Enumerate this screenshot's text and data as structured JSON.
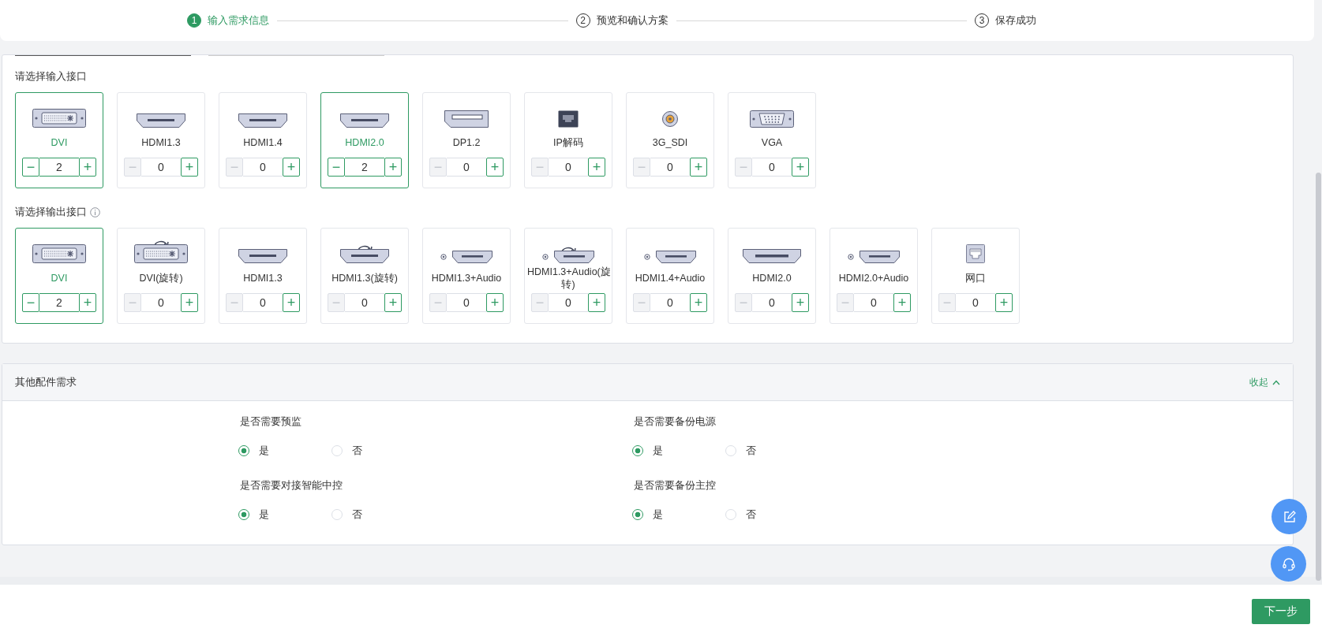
{
  "steps": [
    {
      "number": "1",
      "label": "输入需求信息",
      "selected": true
    },
    {
      "number": "2",
      "label": "预览和确认方案",
      "selected": false
    },
    {
      "number": "3",
      "label": "保存成功",
      "selected": false
    }
  ],
  "input_ports": {
    "title": "请选择输入接口",
    "items": [
      {
        "kind": "dvi",
        "rotated": false,
        "label": "DVI",
        "selected": true,
        "minus_disabled": false,
        "value": "2",
        "minus": "−",
        "plus": "+"
      },
      {
        "kind": "hdmi",
        "rotated": false,
        "label": "HDMI1.3",
        "selected": false,
        "minus_disabled": true,
        "value": "0",
        "minus": "−",
        "plus": "+"
      },
      {
        "kind": "hdmi",
        "rotated": false,
        "label": "HDMI1.4",
        "selected": false,
        "minus_disabled": true,
        "value": "0",
        "minus": "−",
        "plus": "+"
      },
      {
        "kind": "hdmi",
        "rotated": false,
        "label": "HDMI2.0",
        "selected": true,
        "minus_disabled": false,
        "value": "2",
        "minus": "−",
        "plus": "+"
      },
      {
        "kind": "dp",
        "rotated": false,
        "label": "DP1.2",
        "selected": false,
        "minus_disabled": true,
        "value": "0",
        "minus": "−",
        "plus": "+"
      },
      {
        "kind": "ip",
        "rotated": false,
        "label": "IP解码",
        "selected": false,
        "minus_disabled": true,
        "value": "0",
        "minus": "−",
        "plus": "+"
      },
      {
        "kind": "bnc",
        "rotated": false,
        "label": "3G_SDI",
        "selected": false,
        "minus_disabled": true,
        "value": "0",
        "minus": "−",
        "plus": "+"
      },
      {
        "kind": "vga",
        "rotated": false,
        "label": "VGA",
        "selected": false,
        "minus_disabled": true,
        "value": "0",
        "minus": "−",
        "plus": "+"
      }
    ]
  },
  "output_ports": {
    "title": "请选择输出接口",
    "items": [
      {
        "kind": "dvi",
        "rotated": false,
        "label": "DVI",
        "selected": true,
        "minus_disabled": false,
        "value": "2",
        "minus": "−",
        "plus": "+"
      },
      {
        "kind": "dvi",
        "rotated": true,
        "label": "DVI(旋转)",
        "selected": false,
        "minus_disabled": true,
        "value": "0",
        "minus": "−",
        "plus": "+"
      },
      {
        "kind": "hdmi",
        "rotated": false,
        "label": "HDMI1.3",
        "selected": false,
        "minus_disabled": true,
        "value": "0",
        "minus": "−",
        "plus": "+"
      },
      {
        "kind": "hdmi",
        "rotated": true,
        "label": "HDMI1.3(旋转)",
        "selected": false,
        "minus_disabled": true,
        "value": "0",
        "minus": "−",
        "plus": "+"
      },
      {
        "kind": "hdmi-audio",
        "rotated": false,
        "label": "HDMI1.3+Audio",
        "selected": false,
        "minus_disabled": true,
        "value": "0",
        "minus": "−",
        "plus": "+"
      },
      {
        "kind": "hdmi-audio",
        "rotated": true,
        "label": "HDMI1.3+Audio(旋转)",
        "selected": false,
        "minus_disabled": true,
        "value": "0",
        "minus": "−",
        "plus": "+"
      },
      {
        "kind": "hdmi-audio",
        "rotated": false,
        "label": "HDMI1.4+Audio",
        "selected": false,
        "minus_disabled": true,
        "value": "0",
        "minus": "−",
        "plus": "+"
      },
      {
        "kind": "hdmi-large",
        "rotated": false,
        "label": "HDMI2.0",
        "selected": false,
        "minus_disabled": true,
        "value": "0",
        "minus": "−",
        "plus": "+"
      },
      {
        "kind": "hdmi-audio",
        "rotated": false,
        "label": "HDMI2.0+Audio",
        "selected": false,
        "minus_disabled": true,
        "value": "0",
        "minus": "−",
        "plus": "+"
      },
      {
        "kind": "lan",
        "rotated": false,
        "label": "网口",
        "selected": false,
        "minus_disabled": true,
        "value": "0",
        "minus": "−",
        "plus": "+"
      }
    ]
  },
  "accessories": {
    "title": "其他配件需求",
    "collapse": "收起",
    "expanded": true,
    "questions": [
      {
        "question": "是否需要预监",
        "options": [
          {
            "label": "是",
            "selected": true
          },
          {
            "label": "否",
            "selected": false
          }
        ]
      },
      {
        "question": "是否需要备份电源",
        "options": [
          {
            "label": "是",
            "selected": true
          },
          {
            "label": "否",
            "selected": false
          }
        ]
      },
      {
        "question": "是否需要对接智能中控",
        "options": [
          {
            "label": "是",
            "selected": true
          },
          {
            "label": "否",
            "selected": false
          }
        ]
      },
      {
        "question": "是否需要备份主控",
        "options": [
          {
            "label": "是",
            "selected": true
          },
          {
            "label": "否",
            "selected": false
          }
        ]
      }
    ]
  },
  "next_button": "下一步"
}
